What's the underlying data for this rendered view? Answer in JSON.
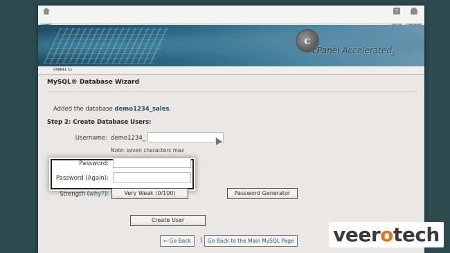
{
  "topbar": {
    "home_label": "HOME",
    "help_label": "HELP",
    "logout_label": "LOGOUT"
  },
  "banner": {
    "logo_prefix": "cPanel",
    "logo_accent": " Accelerated",
    "logo_sub": "2"
  },
  "cpanel_bar": {
    "label": "CPANEL 11"
  },
  "page": {
    "title": "MySQL® Database Wizard",
    "added_prefix": "Added the database ",
    "added_db": "demo1234_sales",
    "added_suffix": ".",
    "step": "Step 2: Create Database Users:"
  },
  "form": {
    "username_label": "Username:",
    "username_prefix": "demo1234_",
    "username_value": "",
    "username_note": "Note: seven characters max",
    "password_label": "Password:",
    "password_value": "",
    "password_again_label": "Password (Again):",
    "password_again_value": "",
    "strength_label": "Strength (",
    "strength_why": "why?",
    "strength_suffix": "):",
    "strength_value": "Very Weak (0/100)",
    "password_generator": "Password Generator",
    "create_user": "Create User"
  },
  "nav": {
    "go_back": "← Go Back",
    "separator": "|",
    "main_mysql": "Go Back to the Main MySQL Page"
  },
  "watermark": {
    "text_1": "veer",
    "text_o": "o",
    "text_2": "tech"
  },
  "colors": {
    "accent_link": "#2b5c80",
    "brand_orange": "#e2761f",
    "background": "#2d4a4e"
  }
}
